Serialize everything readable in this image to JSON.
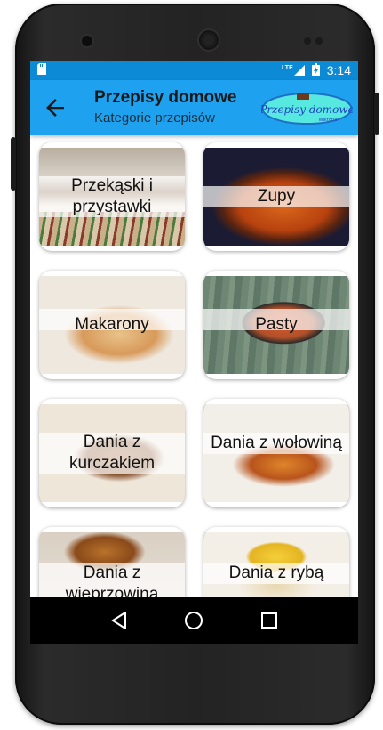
{
  "status": {
    "time": "3:14",
    "network": "LTE"
  },
  "appbar": {
    "title": "Przepisy domowe",
    "subtitle": "Kategorie przepisów",
    "logo_text": "Przepisy domowe",
    "logo_sub": "Wiktoria"
  },
  "categories": [
    {
      "label": "Przekąski i przystawki"
    },
    {
      "label": "Zupy"
    },
    {
      "label": "Makarony"
    },
    {
      "label": "Pasty"
    },
    {
      "label": "Dania z kurczakiem"
    },
    {
      "label": "Dania z wołowiną"
    },
    {
      "label": "Dania z wieprzowiną"
    },
    {
      "label": "Dania z rybą"
    }
  ],
  "colors": {
    "statusbar": "#0d8ad6",
    "appbar": "#1ea1ef"
  }
}
